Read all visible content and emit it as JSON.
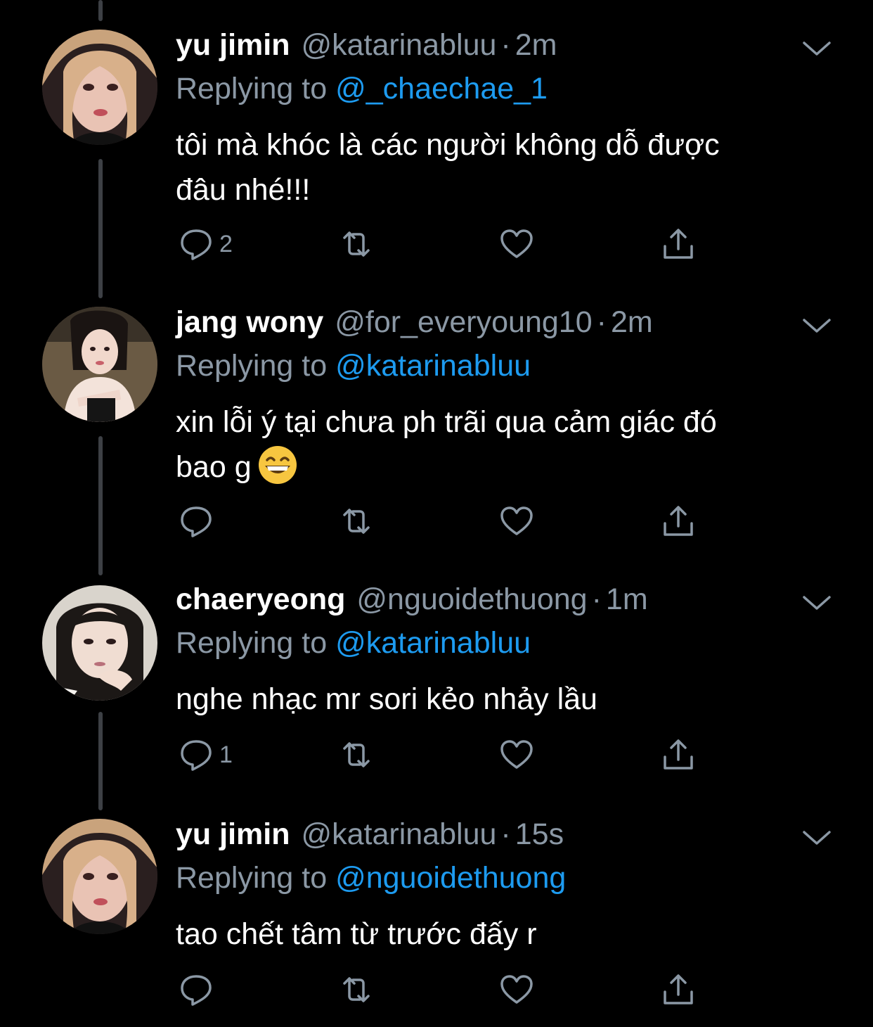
{
  "theme": {
    "background": "#000000",
    "text": "#ffffff",
    "muted": "#8b98a5",
    "accent": "#1d9bf0",
    "thread_line": "#3d4045"
  },
  "tweets": [
    {
      "name": "yu jimin",
      "handle": "@katarinabluu",
      "time": "2m",
      "replying_label": "Replying to",
      "replying_to": "@_chaechae_1",
      "text_line1": "tôi mà khóc là các người không dỗ được",
      "text_line2": "đâu nhé!!!",
      "reply_count": "2",
      "avatar": "avatar-yu-jimin"
    },
    {
      "name": "jang wony",
      "handle": "@for_everyoung10",
      "time": "2m",
      "replying_label": "Replying to",
      "replying_to": "@katarinabluu",
      "text_line1": "xin lỗi ý tại chưa ph trãi qua cảm giác đó",
      "text_line2": "bao g",
      "emoji": "grinning-face-with-smiling-eyes",
      "reply_count": "",
      "avatar": "avatar-jang-wony"
    },
    {
      "name": "chaeryeong",
      "handle": "@nguoidethuong",
      "time": "1m",
      "replying_label": "Replying to",
      "replying_to": "@katarinabluu",
      "text_line1": "nghe nhạc mr sori kẻo nhảy lầu",
      "reply_count": "1",
      "avatar": "avatar-chaeryeong"
    },
    {
      "name": "yu jimin",
      "handle": "@katarinabluu",
      "time": "15s",
      "replying_label": "Replying to",
      "replying_to": "@nguoidethuong",
      "text_line1": "tao chết tâm từ trước đấy r",
      "reply_count": "",
      "avatar": "avatar-yu-jimin"
    }
  ],
  "icons": {
    "reply": "reply-icon",
    "retweet": "retweet-icon",
    "like": "heart-icon",
    "share": "share-icon",
    "more": "chevron-down-icon"
  }
}
